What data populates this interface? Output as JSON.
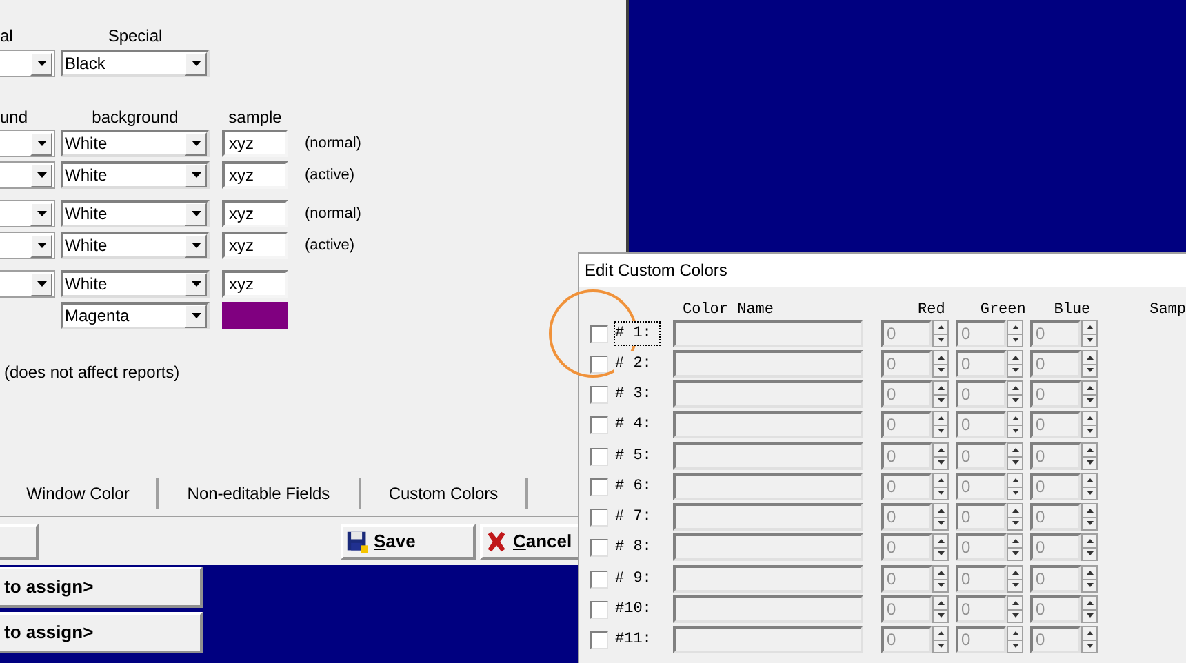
{
  "settings_window": {
    "special_headers": [
      "al",
      "Special"
    ],
    "special_row": [
      {
        "kind": "cut_combo"
      },
      {
        "kind": "combo",
        "value": "Black"
      }
    ],
    "color_headers": [
      "und",
      "background",
      "sample"
    ],
    "color_groups": [
      {
        "rows": [
          {
            "cells": [
              {
                "kind": "cut_combo"
              },
              {
                "kind": "combo",
                "value": "White"
              },
              {
                "kind": "sample",
                "text": "xyz"
              }
            ],
            "note": "(normal)"
          },
          {
            "cells": [
              {
                "kind": "cut_combo"
              },
              {
                "kind": "combo",
                "value": "White"
              },
              {
                "kind": "sample",
                "text": "xyz"
              }
            ],
            "note": "(active)"
          }
        ]
      },
      {
        "rows": [
          {
            "cells": [
              {
                "kind": "cut_combo"
              },
              {
                "kind": "combo",
                "value": "White"
              },
              {
                "kind": "sample",
                "text": "xyz"
              }
            ],
            "note": "(normal)"
          },
          {
            "cells": [
              {
                "kind": "cut_combo"
              },
              {
                "kind": "combo",
                "value": "White"
              },
              {
                "kind": "sample",
                "text": "xyz"
              }
            ],
            "note": "(active)"
          }
        ]
      },
      {
        "rows": [
          {
            "cells": [
              {
                "kind": "cut_combo"
              },
              {
                "kind": "combo",
                "value": "White"
              },
              {
                "kind": "sample",
                "text": "xyz"
              }
            ]
          },
          {
            "cells": [
              {
                "kind": "blank"
              },
              {
                "kind": "combo",
                "value": "Magenta"
              },
              {
                "kind": "swatch",
                "color": "#800080"
              }
            ]
          }
        ]
      }
    ],
    "footnote": "(does not affect reports)",
    "section_buttons": [
      "Window Color",
      "Non-editable Fields",
      "Custom Colors"
    ],
    "action_buttons": [
      {
        "kind": "save",
        "label": "Save"
      },
      {
        "kind": "cancel",
        "label": "Cancel"
      }
    ]
  },
  "assign_list": [
    "to assign>",
    "to assign>"
  ],
  "custom_colors_dialog": {
    "title": "Edit Custom Colors",
    "headers": [
      "Color Name",
      "Red",
      "Green",
      "Blue",
      "Samp"
    ],
    "groups": [
      {
        "rows": [
          {
            "label": "# 1:",
            "checked": false,
            "focused": true,
            "red": "0",
            "green": "0",
            "blue": "0"
          },
          {
            "label": "# 2:",
            "checked": false,
            "focused": false,
            "red": "0",
            "green": "0",
            "blue": "0"
          },
          {
            "label": "# 3:",
            "checked": false,
            "focused": false,
            "red": "0",
            "green": "0",
            "blue": "0"
          },
          {
            "label": "# 4:",
            "checked": false,
            "focused": false,
            "red": "0",
            "green": "0",
            "blue": "0"
          }
        ]
      },
      {
        "rows": [
          {
            "label": "# 5:",
            "checked": false,
            "focused": false,
            "red": "0",
            "green": "0",
            "blue": "0"
          },
          {
            "label": "# 6:",
            "checked": false,
            "focused": false,
            "red": "0",
            "green": "0",
            "blue": "0"
          },
          {
            "label": "# 7:",
            "checked": false,
            "focused": false,
            "red": "0",
            "green": "0",
            "blue": "0"
          },
          {
            "label": "# 8:",
            "checked": false,
            "focused": false,
            "red": "0",
            "green": "0",
            "blue": "0"
          }
        ]
      },
      {
        "rows": [
          {
            "label": "# 9:",
            "checked": false,
            "focused": false,
            "red": "0",
            "green": "0",
            "blue": "0"
          },
          {
            "label": "#10:",
            "checked": false,
            "focused": false,
            "red": "0",
            "green": "0",
            "blue": "0"
          },
          {
            "label": "#11:",
            "checked": false,
            "focused": false,
            "red": "0",
            "green": "0",
            "blue": "0"
          }
        ]
      }
    ]
  }
}
